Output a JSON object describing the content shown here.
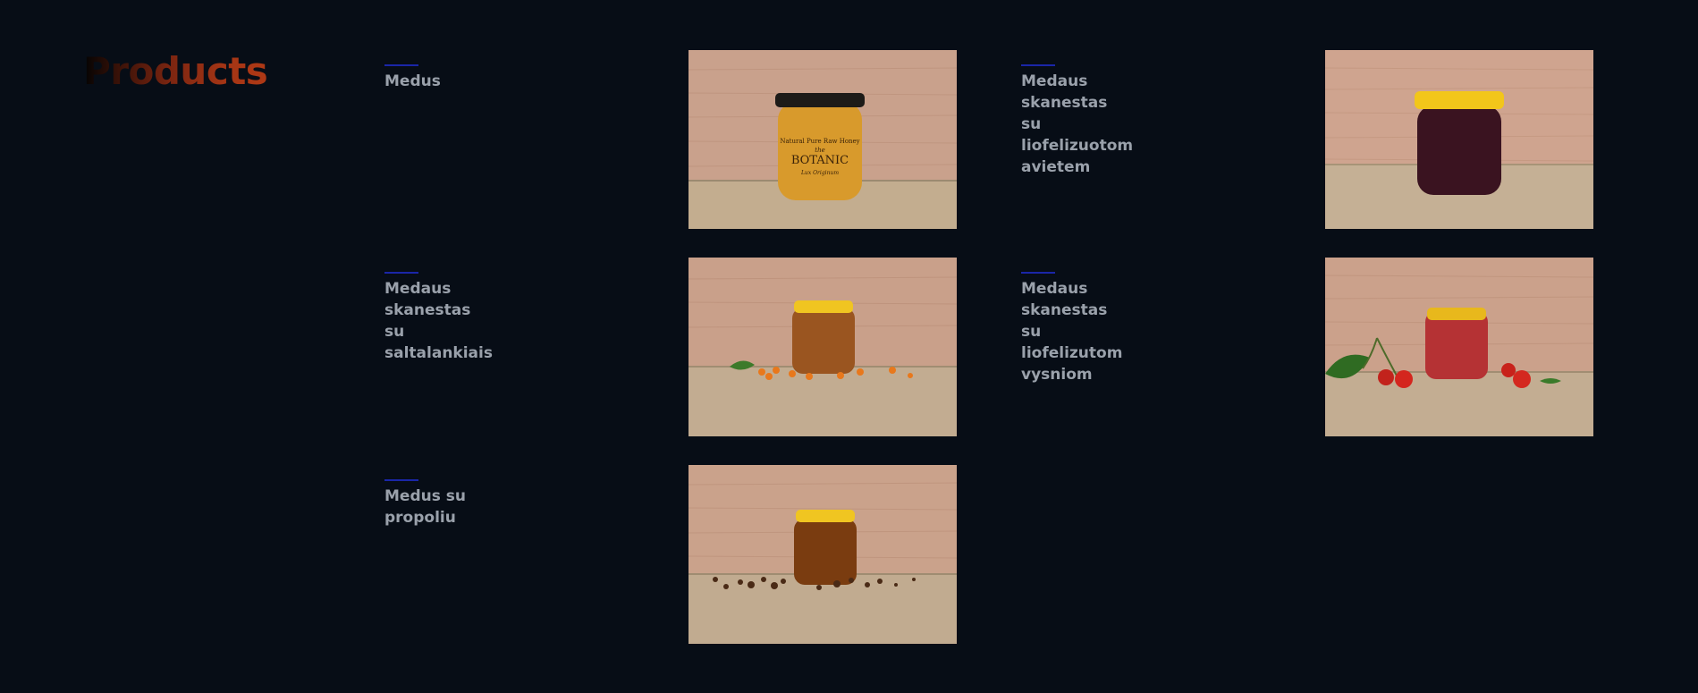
{
  "page": {
    "title": "Products"
  },
  "products": [
    {
      "name": "Medus",
      "image_alt": "jar-botanic-honey",
      "label_lines": [
        "Natural Pure Raw Honey",
        "the",
        "BOTANIC",
        "Lux Originum"
      ],
      "lid_color": "#1d1b18",
      "content_color": "#d89a2c",
      "scatter": "none"
    },
    {
      "name": "Medaus skanestas su liofelizuotom avietem",
      "image_alt": "jar-raspberry-honey",
      "lid_color": "#f2c61a",
      "content_color": "#3a1320",
      "scatter": "none"
    },
    {
      "name": "Medaus skanestas su saltalankiais",
      "image_alt": "jar-sea-buckthorn-honey",
      "lid_color": "#f0c521",
      "content_color": "#9a5520",
      "scatter": "sea-buckthorn"
    },
    {
      "name": "Medaus skanestas su liofelizutom vysniom",
      "image_alt": "jar-cherry-honey",
      "lid_color": "#e8b81c",
      "content_color": "#b53234",
      "scatter": "cherries"
    },
    {
      "name": "Medus su propoliu",
      "image_alt": "jar-propolis-honey",
      "lid_color": "#f0c521",
      "content_color": "#7a3c10",
      "scatter": "propolis"
    }
  ],
  "colors": {
    "background": "#070d16",
    "accent_line": "#1a26a8",
    "product_name": "#9aa1ab",
    "title_gradient_end": "#ad3815"
  }
}
